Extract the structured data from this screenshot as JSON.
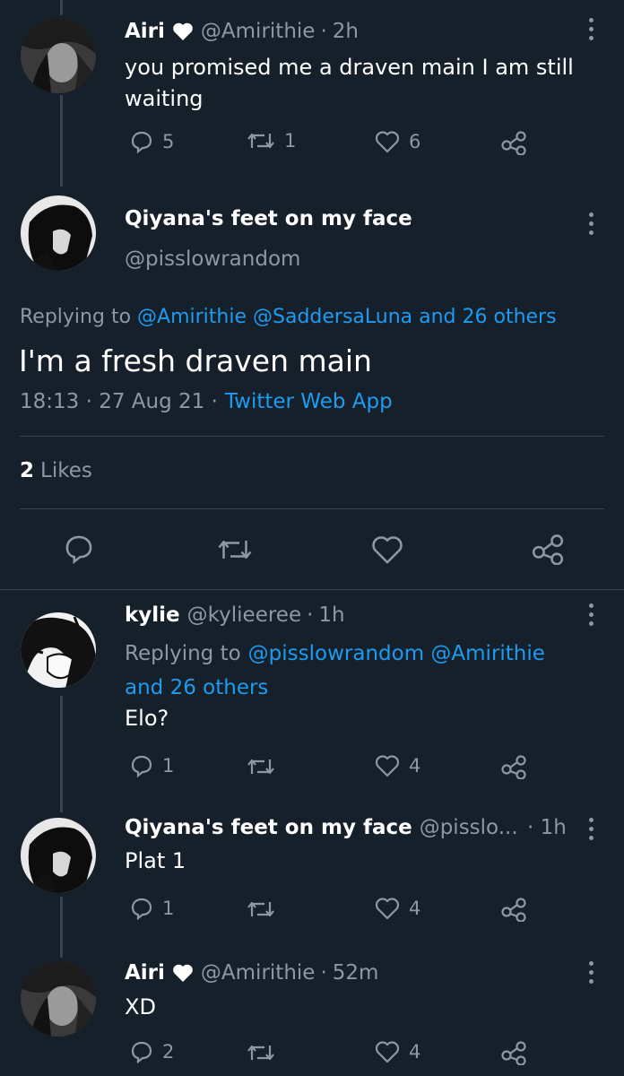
{
  "tweets": [
    {
      "name": "Airi",
      "handle": "@Amirithie",
      "time": "2h",
      "text_line1": "you promised me a draven main I am still",
      "text_line2": "waiting",
      "replies": "5",
      "retweets": "1",
      "likes": "6"
    },
    {
      "name": "kylie",
      "handle": "@kylieeree",
      "time": "1h",
      "replying_prefix": "Replying to",
      "replying_users": "@pisslowrandom @Amirithie",
      "replying_others": "and 26 others",
      "text": "Elo?",
      "replies": "1",
      "likes": "4"
    },
    {
      "name": "Qiyana's feet on my face",
      "handle": "@pisslo...",
      "time": "· 1h",
      "text": "Plat 1",
      "replies": "1",
      "likes": "4"
    },
    {
      "name": "Airi",
      "handle": "@Amirithie",
      "time": "52m",
      "text": "XD",
      "replies": "2",
      "likes": "4"
    }
  ],
  "main": {
    "name": "Qiyana's feet on my face",
    "handle": "@pisslowrandom",
    "replying_prefix": "Replying to",
    "replying_users": "@Amirithie @SaddersaLuna and 26 others",
    "text": "I'm a fresh draven main",
    "timestamp": "18:13 · 27 Aug 21 ·",
    "source": "Twitter Web App",
    "likes_count": "2",
    "likes_label": "Likes"
  },
  "separator": "·",
  "colors": {
    "background": "#15202b",
    "link": "#1d9bf0",
    "muted": "#8b98a5",
    "divider": "#38444d"
  }
}
